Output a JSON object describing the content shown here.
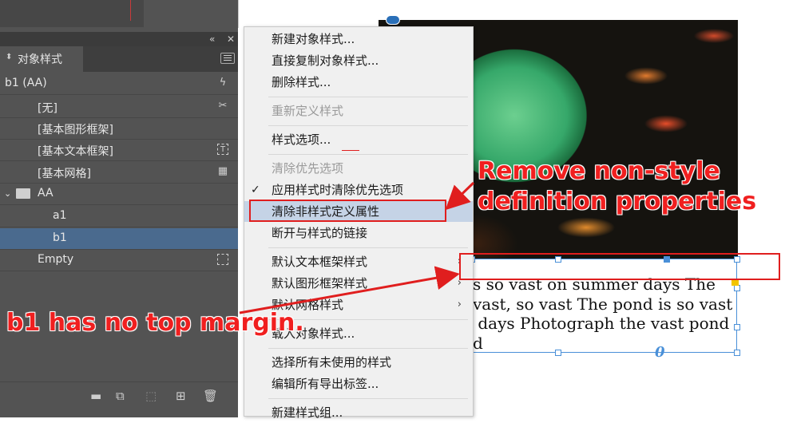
{
  "panel": {
    "tab_label": "对象样式",
    "current_style": "b1 (AA)",
    "close_glyph": "✕",
    "collapse_glyph": "«",
    "rows": [
      {
        "label": "[无]",
        "icon": "no-style-icon"
      },
      {
        "label": "[基本图形框架]",
        "icon": ""
      },
      {
        "label": "[基本文本框架]",
        "icon": "text-frame-icon"
      },
      {
        "label": "[基本网格]",
        "icon": "grid-icon"
      },
      {
        "label": "AA",
        "icon": "folder-icon"
      },
      {
        "label": "a1",
        "icon": ""
      },
      {
        "label": "b1",
        "icon": ""
      },
      {
        "label": "Empty",
        "icon": "frame-dashed-icon"
      }
    ]
  },
  "menu": {
    "items": [
      {
        "label": "新建对象样式...",
        "enabled": true
      },
      {
        "label": "直接复制对象样式...",
        "enabled": true
      },
      {
        "label": "删除样式...",
        "enabled": true
      },
      {
        "label": "重新定义样式",
        "enabled": false
      },
      {
        "label": "样式选项...",
        "enabled": true
      },
      {
        "label": "清除优先选项",
        "enabled": false
      },
      {
        "label": "应用样式时清除优先选项",
        "enabled": true,
        "checked": true
      },
      {
        "label": "清除非样式定义属性",
        "enabled": true,
        "highlighted": true
      },
      {
        "label": "断开与样式的链接",
        "enabled": true
      },
      {
        "label": "默认文本框架样式",
        "enabled": true,
        "submenu": true
      },
      {
        "label": "默认图形框架样式",
        "enabled": true,
        "submenu": true
      },
      {
        "label": "默认网格样式",
        "enabled": true,
        "submenu": true
      },
      {
        "label": "载入对象样式...",
        "enabled": true
      },
      {
        "label": "选择所有未使用的样式",
        "enabled": true
      },
      {
        "label": "编辑所有导出标签...",
        "enabled": true
      },
      {
        "label": "新建样式组...",
        "enabled": true
      }
    ]
  },
  "canvas": {
    "text_lines": [
      "s so vast on summer days The",
      "vast, so vast The pond is so vast",
      " days Photograph the vast pond",
      "d"
    ],
    "overflow_mark": "0"
  },
  "annotations": {
    "remove_line1": "Remove non-style",
    "remove_line2": "definition properties",
    "b1_note": "b1 has no top margin."
  },
  "colors": {
    "annotation_red": "#e01e1e",
    "selection_blue": "#4a6a8e",
    "menu_highlight": "#c5d3e6"
  }
}
